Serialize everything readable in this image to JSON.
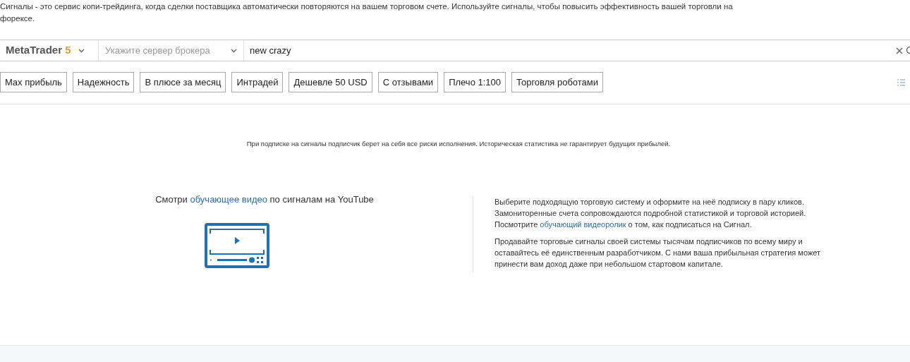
{
  "intro": "Сигналы - это сервис копи-трейдинга, когда сделки поставщика автоматически повторяются на вашем торговом счете. Используйте сигналы, чтобы повысить эффективность вашей торговли на форексе.",
  "search_bar": {
    "platform": {
      "name": "MetaTrader",
      "version": "5"
    },
    "server": {
      "placeholder": "Укажите сервер брокера"
    },
    "query": {
      "value": "new crazy"
    }
  },
  "filters": [
    {
      "label": "Max прибыль"
    },
    {
      "label": "Надежность"
    },
    {
      "label": "В плюсе за месяц"
    },
    {
      "label": "Интрадей"
    },
    {
      "label": "Дешевле 50 USD"
    },
    {
      "label": "С отзывами"
    },
    {
      "label": "Плечо 1:100"
    },
    {
      "label": "Торговля роботами"
    }
  ],
  "disclaimer": "При подписке на сигналы подписчик берет на себя все риски исполнения. Историческая статистика не гарантирует будущих прибылей.",
  "video_promo": {
    "before": "Смотри ",
    "link": "обучающее видео",
    "after": " по сигналам на YouTube"
  },
  "info": [
    {
      "before": "Выберите подходящую торговую систему и оформите на неё подписку в пару кликов. Замониторенные счета сопровождаются подробной статистикой и торговой историей. Посмотрите ",
      "link": "обучающий видеоролик",
      "after": " о том, как подписаться на Сигнал."
    },
    {
      "before": "Продавайте торговые сигналы своей системы тысячам подписчиков по всему миру и оставайтесь её единственным разработчиком. С нами ваша прибыльная стратегия может принести вам доход даже при небольшом стартовом капитале."
    }
  ]
}
